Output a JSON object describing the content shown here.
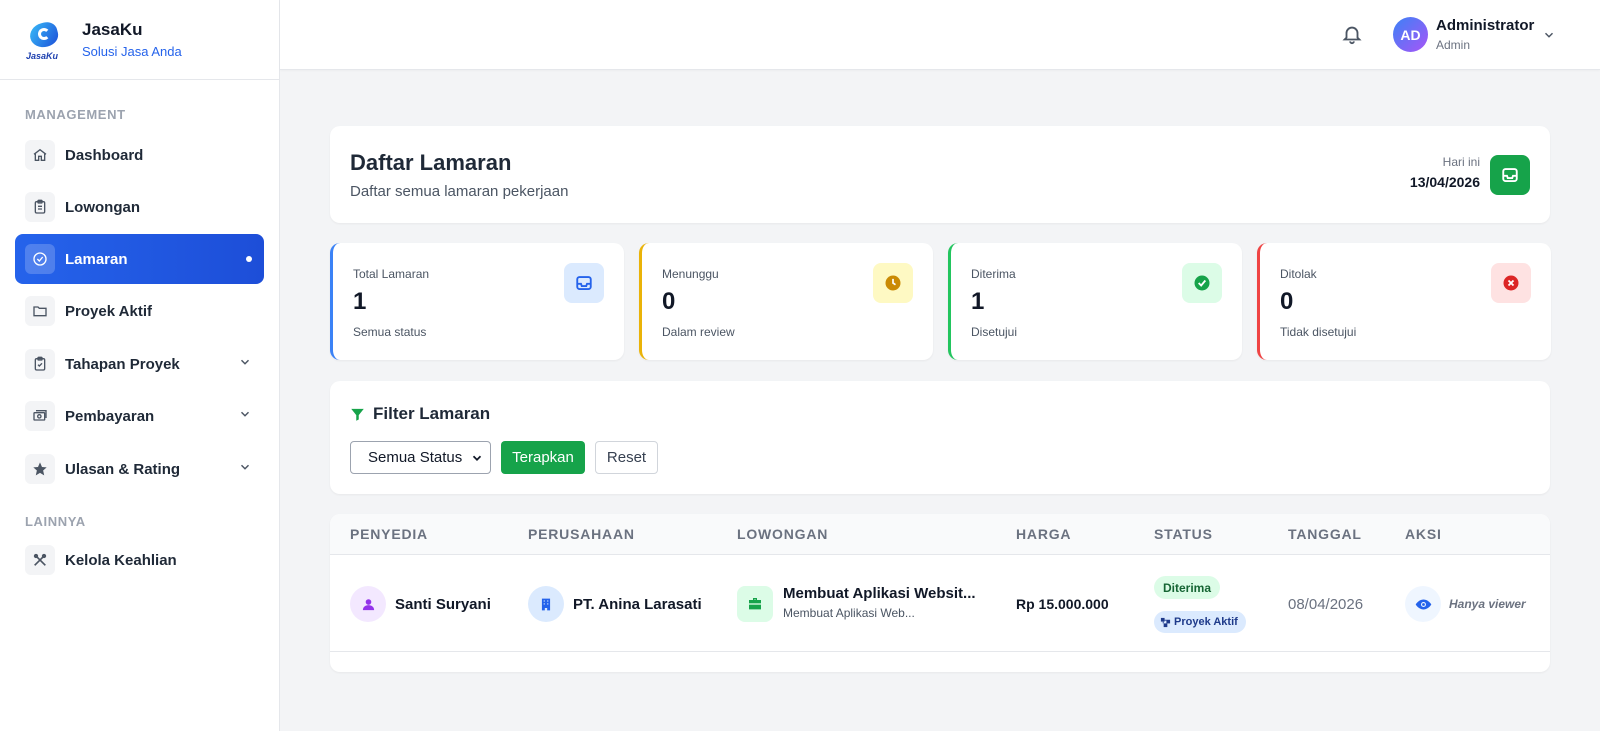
{
  "brand": {
    "name": "JasaKu",
    "tagline": "Solusi Jasa Anda",
    "logo_text": "JasaKu"
  },
  "sidebar": {
    "section_management": "MANAGEMENT",
    "section_other": "LAINNYA",
    "items": [
      {
        "label": "Dashboard",
        "icon": "home-icon"
      },
      {
        "label": "Lowongan",
        "icon": "clipboard-icon"
      },
      {
        "label": "Lamaran",
        "icon": "check-circle-icon",
        "active": true
      },
      {
        "label": "Proyek Aktif",
        "icon": "folder-icon"
      },
      {
        "label": "Tahapan Proyek",
        "icon": "clipboard-check-icon",
        "expandable": true
      },
      {
        "label": "Pembayaran",
        "icon": "money-icon",
        "expandable": true
      },
      {
        "label": "Ulasan & Rating",
        "icon": "star-icon",
        "expandable": true
      }
    ],
    "other_items": [
      {
        "label": "Kelola Keahlian",
        "icon": "tools-icon"
      }
    ]
  },
  "header": {
    "avatar_initials": "AD",
    "user_name": "Administrator",
    "user_role": "Admin"
  },
  "page": {
    "title": "Daftar Lamaran",
    "subtitle": "Daftar semua lamaran pekerjaan",
    "today_label": "Hari ini",
    "today_value": "13/04/2026"
  },
  "stats": [
    {
      "label": "Total Lamaran",
      "value": "1",
      "sub": "Semua status",
      "color": "#3b82f6"
    },
    {
      "label": "Menunggu",
      "value": "0",
      "sub": "Dalam review",
      "color": "#eab308"
    },
    {
      "label": "Diterima",
      "value": "1",
      "sub": "Disetujui",
      "color": "#22c55e"
    },
    {
      "label": "Ditolak",
      "value": "0",
      "sub": "Tidak disetujui",
      "color": "#ef4444"
    }
  ],
  "filter": {
    "title": "Filter Lamaran",
    "status_selected": "Semua Status",
    "apply_label": "Terapkan",
    "reset_label": "Reset"
  },
  "table": {
    "columns": [
      "PENYEDIA",
      "PERUSAHAAN",
      "LOWONGAN",
      "HARGA",
      "STATUS",
      "TANGGAL",
      "AKSI"
    ],
    "rows": [
      {
        "provider": "Santi Suryani",
        "company": "PT. Anina Larasati",
        "job_title": "Membuat Aplikasi Websit...",
        "job_sub": "Membuat Aplikasi Web...",
        "price": "Rp 15.000.000",
        "status": "Diterima",
        "project_badge": "Proyek Aktif",
        "date": "08/04/2026",
        "action_text": "Hanya viewer"
      }
    ]
  }
}
